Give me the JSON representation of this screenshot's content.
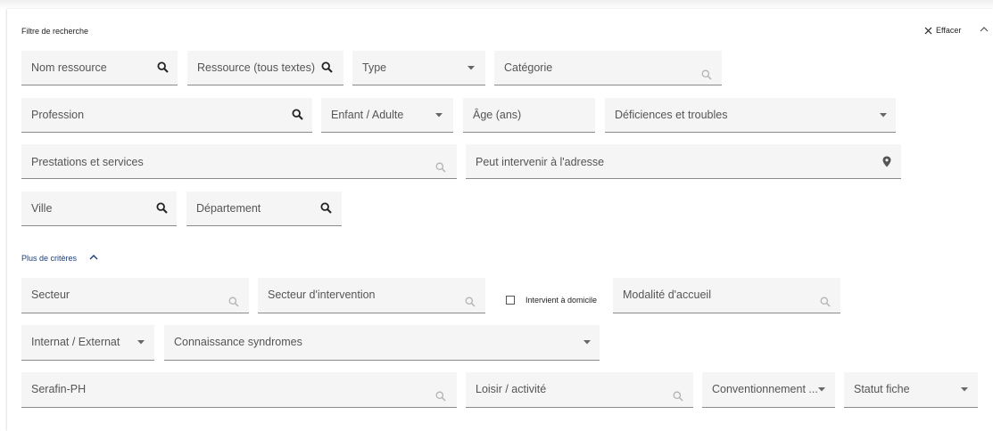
{
  "filter": {
    "title": "Filtre de recherche",
    "clear_label": "Effacer",
    "more_criteria_label": "Plus de critères"
  },
  "fields": {
    "nom_ressource": "Nom ressource",
    "ressource_tous_textes": "Ressource (tous textes)",
    "type": "Type",
    "categorie": "Catégorie",
    "profession": "Profession",
    "enfant_adulte": "Enfant / Adulte",
    "age": "Âge (ans)",
    "deficiences": "Déficiences et troubles",
    "prestations": "Prestations et services",
    "adresse": "Peut intervenir à l'adresse",
    "ville": "Ville",
    "departement": "Département",
    "secteur": "Secteur",
    "secteur_intervention": "Secteur d'intervention",
    "intervient_domicile": "Intervient à domicile",
    "modalite_accueil": "Modalité d'accueil",
    "internat_externat": "Internat / Externat",
    "connaissance_syndromes": "Connaissance syndromes",
    "serafin": "Serafin-PH",
    "loisir": "Loisir / activité",
    "conventionnement": "Conventionnement ...",
    "statut_fiche": "Statut fiche"
  }
}
